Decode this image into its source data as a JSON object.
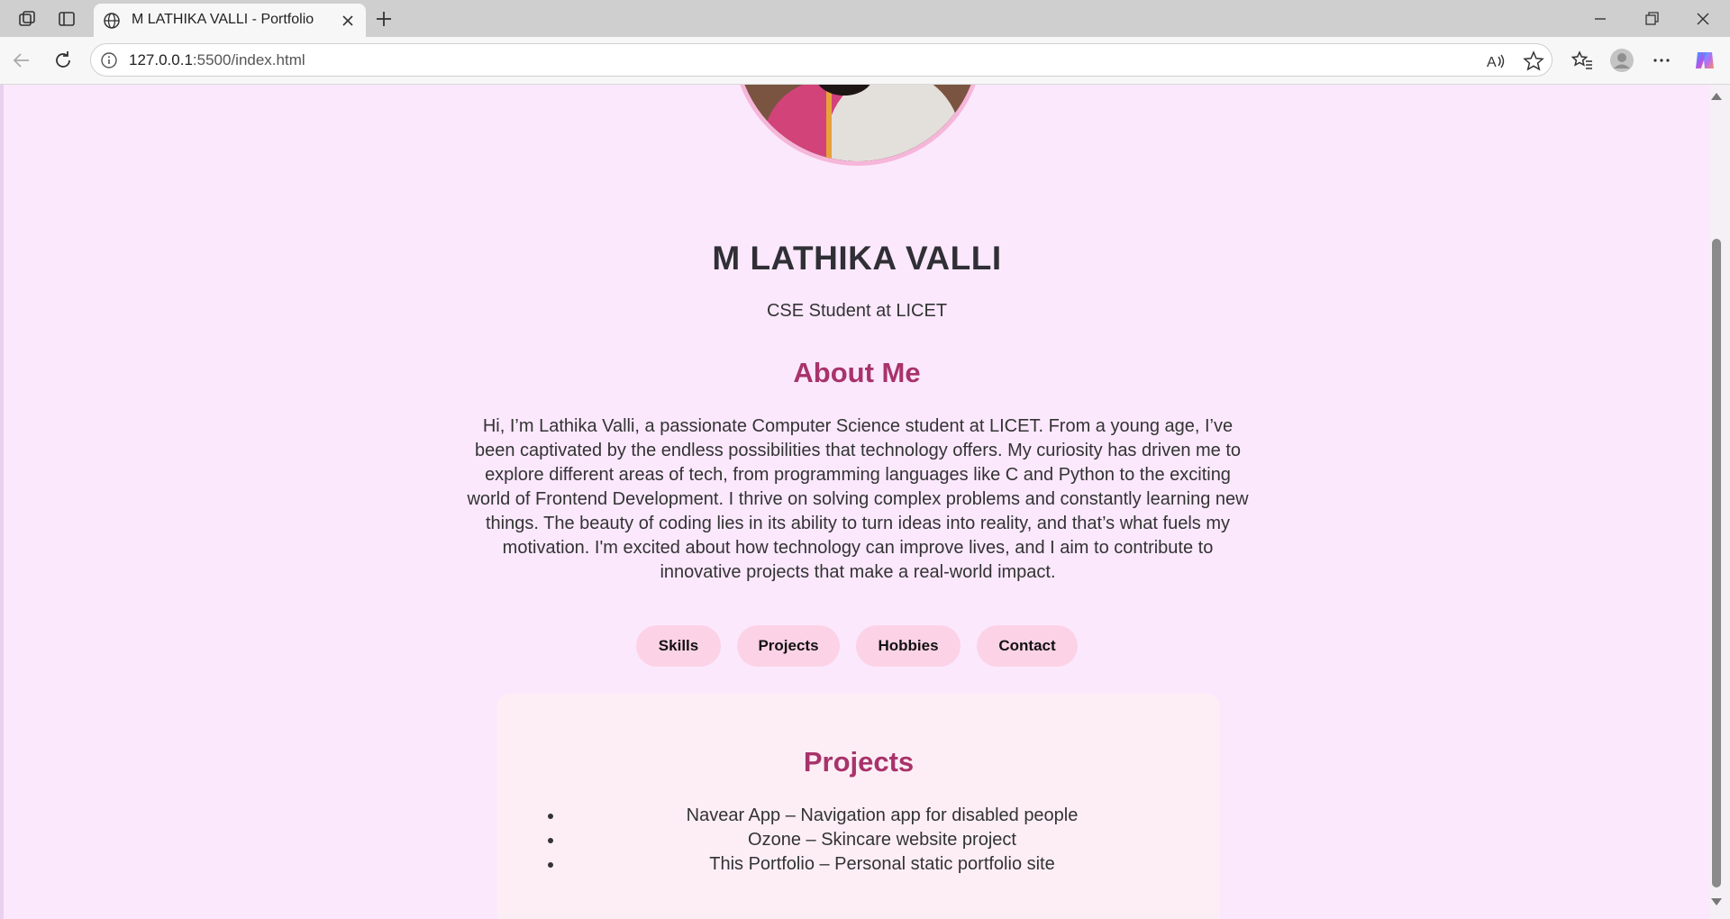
{
  "browser": {
    "tab_title": "M LATHIKA VALLI - Portfolio",
    "url_host": "127.0.0.1",
    "url_path": ":5500/index.html",
    "icons": [
      "workspaces-icon",
      "tab-actions-icon",
      "globe-icon",
      "close-icon",
      "plus-icon",
      "minimize-icon",
      "restore-icon",
      "window-close-icon",
      "back-icon",
      "refresh-icon",
      "info-icon",
      "read-aloud-icon",
      "star-icon",
      "favorites-icon",
      "profile-icon",
      "more-icon",
      "copilot-icon"
    ]
  },
  "profile": {
    "name": "M LATHIKA VALLI",
    "subtitle": "CSE Student at LICET"
  },
  "about": {
    "heading": "About Me",
    "text": "Hi, I’m Lathika Valli, a passionate Computer Science student at LICET. From a young age, I’ve been captivated by the endless possibilities that technology offers. My curiosity has driven me to explore different areas of tech, from programming languages like C and Python to the exciting world of Frontend Development. I thrive on solving complex problems and constantly learning new things. The beauty of coding lies in its ability to turn ideas into reality, and that’s what fuels my motivation. I'm excited about how technology can improve lives, and I aim to contribute to innovative projects that make a real-world impact."
  },
  "nav": {
    "items": [
      {
        "label": "Skills"
      },
      {
        "label": "Projects"
      },
      {
        "label": "Hobbies"
      },
      {
        "label": "Contact"
      }
    ]
  },
  "projects": {
    "heading": "Projects",
    "items": [
      "Navear App – Navigation app for disabled people",
      "Ozone – Skincare website project",
      "This Portfolio – Personal static portfolio site"
    ]
  },
  "colors": {
    "page_bg": "#fbe8fd",
    "accent": "#a8336a",
    "pill_bg": "#fcd3e6",
    "card_bg": "#fdeef6"
  }
}
